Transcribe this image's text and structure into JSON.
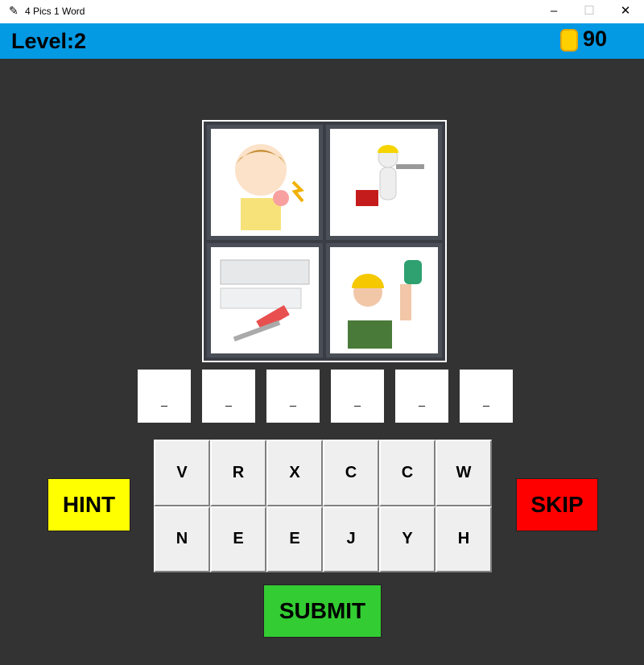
{
  "window": {
    "title": "4 Pics 1 Word",
    "controls": [
      "minimize",
      "maximize",
      "close"
    ]
  },
  "header": {
    "level": "Level:2",
    "coins": "90",
    "coin_icon": "gem-coin-icon",
    "bg": "#0399e3"
  },
  "pictures": [
    "girl-with-shoulder-pain",
    "worker-with-wrench-and-toolbox",
    "blueprints-and-wrench",
    "woman-in-hard-hat-with-wrench"
  ],
  "slots": [
    "_",
    "_",
    "_",
    "_",
    "_",
    "_"
  ],
  "keys": [
    "V",
    "R",
    "X",
    "C",
    "C",
    "W",
    "N",
    "E",
    "E",
    "J",
    "Y",
    "H"
  ],
  "buttons": {
    "hint": "HINT",
    "skip": "SKIP",
    "submit": "SUBMIT"
  },
  "colors": {
    "hint": "#ffff00",
    "skip": "#ff0000",
    "submit": "#33cc33"
  }
}
